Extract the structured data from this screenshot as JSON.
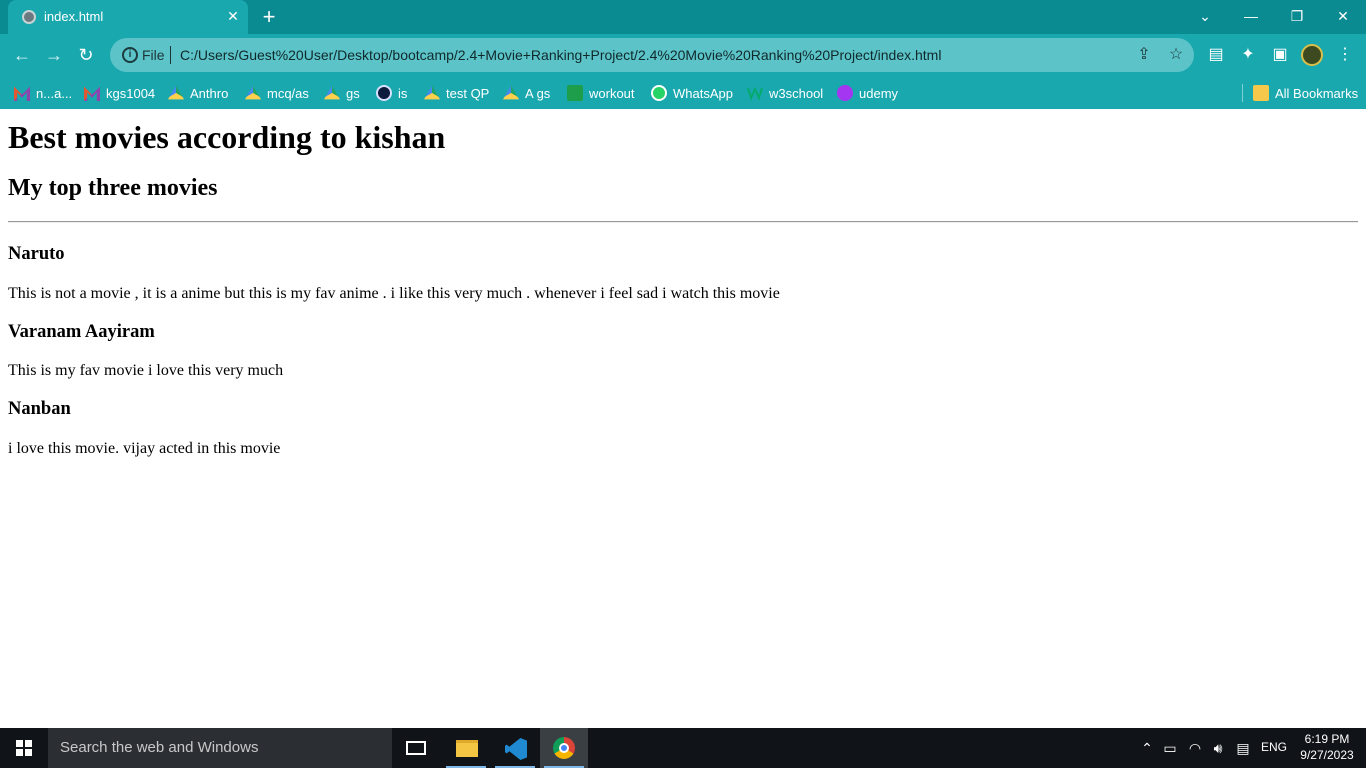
{
  "browser": {
    "tab_title": "index.html",
    "scheme_label": "File",
    "url": "C:/Users/Guest%20User/Desktop/bootcamp/2.4+Movie+Ranking+Project/2.4%20Movie%20Ranking%20Project/index.html"
  },
  "bookmarks": [
    {
      "label": "n...a...",
      "icon": "gmail-icon"
    },
    {
      "label": "kgs1004",
      "icon": "gmail-icon"
    },
    {
      "label": "Anthro",
      "icon": "drive-icon"
    },
    {
      "label": "mcq/as",
      "icon": "drive-icon"
    },
    {
      "label": "gs",
      "icon": "drive-icon"
    },
    {
      "label": "is",
      "icon": "site-icon"
    },
    {
      "label": "test QP",
      "icon": "drive-icon"
    },
    {
      "label": "A gs",
      "icon": "drive-icon"
    },
    {
      "label": "workout",
      "icon": "sheets-icon"
    },
    {
      "label": "WhatsApp",
      "icon": "whatsapp-icon"
    },
    {
      "label": "w3school",
      "icon": "w3schools-icon"
    },
    {
      "label": "udemy",
      "icon": "udemy-icon"
    }
  ],
  "all_bookmarks_label": "All Bookmarks",
  "page": {
    "heading": "Best movies according to kishan",
    "subheading": "My top three movies",
    "movies": [
      {
        "title": "Naruto",
        "description": "This is not a movie , it is a anime but this is my fav anime . i like this very much . whenever i feel sad i watch this movie"
      },
      {
        "title": "Varanam Aayiram",
        "description": "This is my fav movie i love this very much"
      },
      {
        "title": "Nanban",
        "description": "i love this movie. vijay acted in this movie"
      }
    ]
  },
  "taskbar": {
    "search_placeholder": "Search the web and Windows",
    "language": "ENG",
    "time": "6:19 PM",
    "date": "9/27/2023"
  }
}
